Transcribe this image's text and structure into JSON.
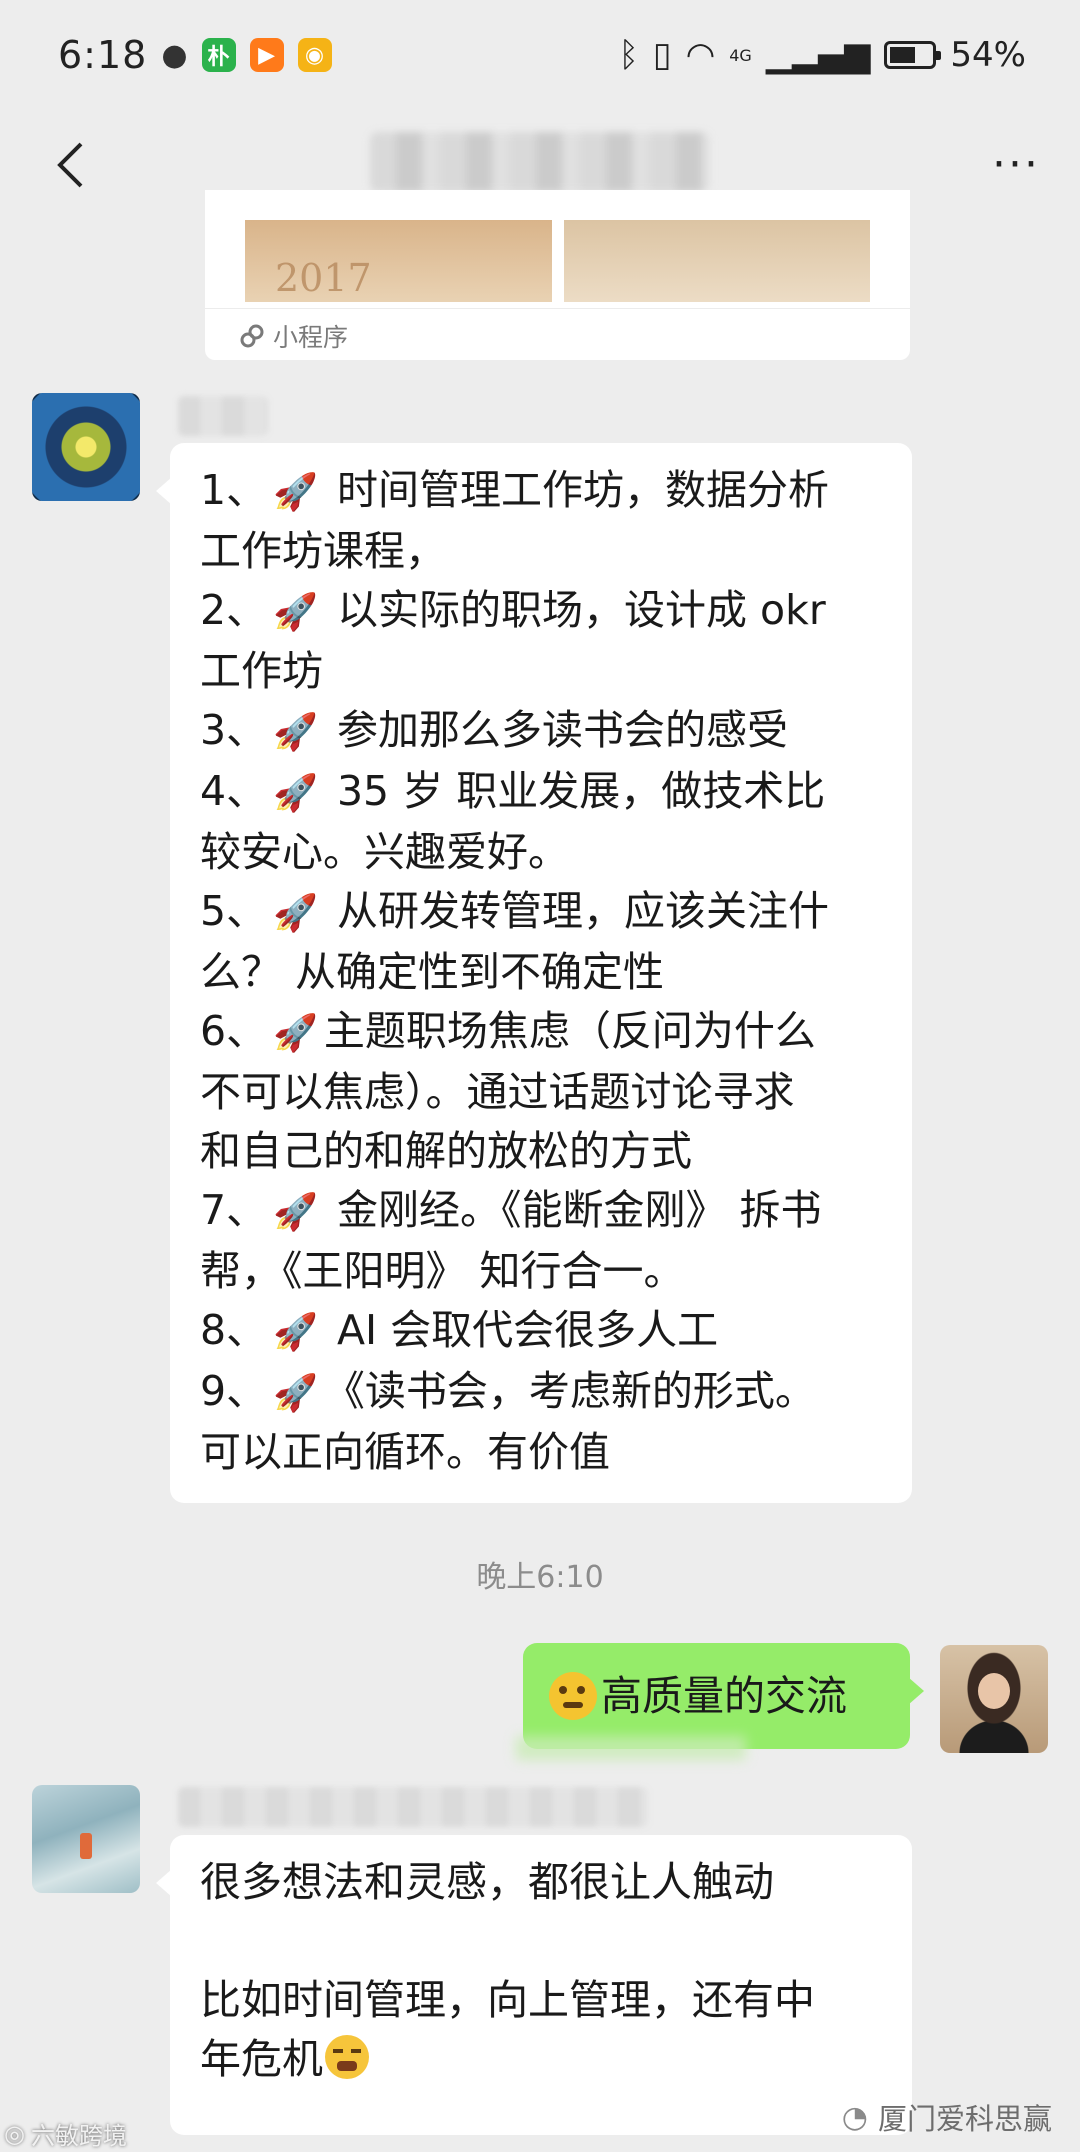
{
  "status_bar": {
    "time": "6:18",
    "battery": "54%",
    "network": "4G"
  },
  "nav": {
    "back_icon": "chevron-left-icon",
    "more_label": "···"
  },
  "mini_program": {
    "thumb_text": "2017",
    "label": "小程序"
  },
  "messages": {
    "list_items": [
      [
        "1、",
        "🚀",
        " 时间管理工作坊，数据分析"
      ],
      [
        "",
        "",
        "工作坊课程，"
      ],
      [
        "2、",
        "🚀",
        " 以实际的职场，设计成 okr"
      ],
      [
        "",
        "",
        "工作坊"
      ],
      [
        "3、",
        "🚀",
        " 参加那么多读书会的感受"
      ],
      [
        "4、",
        "🚀",
        " 35 岁 职业发展，做技术比"
      ],
      [
        "",
        "",
        "较安心。兴趣爱好。"
      ],
      [
        "5、",
        "🚀",
        " 从研发转管理，应该关注什"
      ],
      [
        "",
        "",
        "么？ 从确定性到不确定性"
      ],
      [
        "6、",
        "🚀",
        "主题职场焦虑（反问为什么"
      ],
      [
        "",
        "",
        "不可以焦虑）。通过话题讨论寻求"
      ],
      [
        "",
        "",
        "和自己的和解的放松的方式"
      ],
      [
        "7、",
        "🚀",
        " 金刚经。《能断金刚》 拆书"
      ],
      [
        "",
        "",
        "帮，《王阳明》 知行合一。"
      ],
      [
        "8、",
        "🚀",
        " AI 会取代会很多人工"
      ],
      [
        "9、",
        "🚀",
        "《读书会，考虑新的形式。"
      ],
      [
        "",
        "",
        "可以正向循环。有价值"
      ]
    ],
    "timestamp": "晚上6:10",
    "my_reply": "高质量的交流",
    "third": {
      "line1": "很多想法和灵感，都很让人触动",
      "line2": "比如时间管理，向上管理，还有中",
      "line3": "年危机"
    }
  },
  "watermarks": {
    "right": "厦门爱科思赢",
    "left": "六敏跨境"
  },
  "colors": {
    "background": "#ededed",
    "bubble_white": "#ffffff",
    "bubble_green": "#95ec69"
  }
}
